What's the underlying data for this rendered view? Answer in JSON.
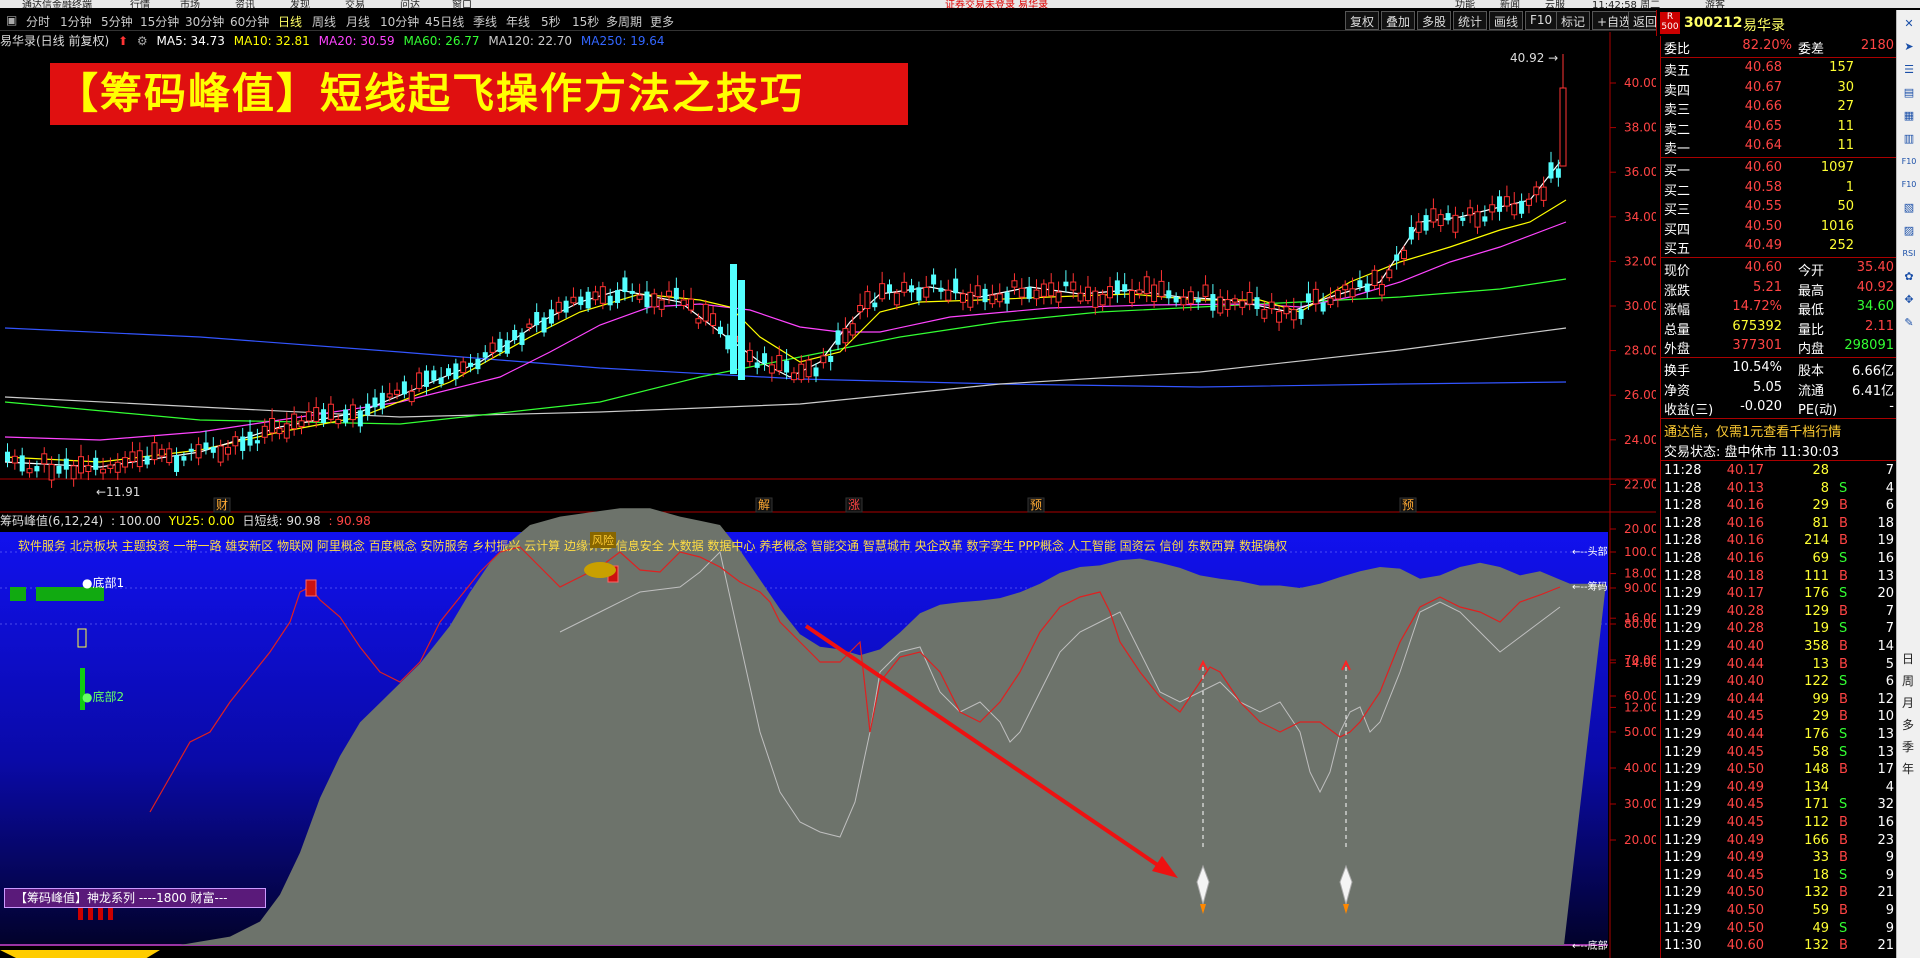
{
  "topbar": {
    "left_text": "通达信金融终端",
    "menus": [
      "行情",
      "市场",
      "资讯",
      "发现",
      "交易",
      "问达",
      "窗口"
    ],
    "center_text": "证券交易未登录  易华录",
    "right": [
      "功能",
      "新闻",
      "云服",
      "11:42:58 周二",
      "游客"
    ]
  },
  "periods": [
    "分时",
    "1分钟",
    "5分钟",
    "15分钟",
    "30分钟",
    "60分钟",
    "日线",
    "周线",
    "月线",
    "10分钟",
    "45日线",
    "季线",
    "年线",
    "5秒",
    "15秒",
    "多周期",
    "更多"
  ],
  "active_period": "日线",
  "toolbar": [
    "复权",
    "叠加",
    "多股",
    "统计",
    "画线",
    "F10",
    "标记",
    "+自选",
    "返回"
  ],
  "stock": {
    "rank_label": "R",
    "rank_num": "500",
    "code": "300212",
    "name": "易华录"
  },
  "ma_line": {
    "title": "易华录(日线 前复权)",
    "ma5": "MA5: 34.73",
    "ma10": "MA10: 32.81",
    "ma20": "MA20: 30.59",
    "ma60": "MA60: 26.77",
    "ma120": "MA120: 22.70",
    "ma250": "MA250: 19.64",
    "colors": {
      "ma5": "#ffffff",
      "ma10": "#ffff00",
      "ma20": "#ff44ff",
      "ma60": "#33ff33",
      "ma120": "#cccccc",
      "ma250": "#3355ff"
    }
  },
  "banner_text": "【筹码峰值】短线起飞操作方法之技巧",
  "price_axis": [
    "40.00",
    "38.00",
    "36.00",
    "34.00",
    "32.00",
    "30.00",
    "28.00",
    "26.00",
    "24.00",
    "22.00",
    "20.00",
    "18.00",
    "16.00",
    "14.00",
    "12.00"
  ],
  "high_label": "40.92",
  "low_label": "11.91",
  "event_marks": [
    "财",
    "解",
    "涨",
    "预",
    "预"
  ],
  "indicator": {
    "title": "筹码峰值(6,12,24)",
    "v1": ": 100.00",
    "yu25": "YU25: 0.00",
    "short": "日短线: 90.98",
    "v2": ": 90.98",
    "axis": [
      "100.0",
      "90.00",
      "80.00",
      "70.00",
      "60.00",
      "50.00",
      "40.00",
      "30.00",
      "20.00"
    ],
    "right_tags": [
      "头部",
      "筹码",
      "底部"
    ],
    "sectors": "软件服务 北京板块 主题投资 一带一路 雄安新区 物联网 阿里概念 百度概念 安防服务 乡村振兴 云计算 边缘计算 信息安全 大数据 数据中心 养老概念 智能交通 智慧城市 央企改革 数字孪生 PPP概念 人工智能 国资云 信创 东数西算 数据确权",
    "risk": "风险",
    "bottom1": "●底部1",
    "bottom2": "●底部2",
    "badge": "【筹码峰值】神龙系列 ----1800 财富---"
  },
  "quote": {
    "weibi_label": "委比",
    "weibi": "82.20%",
    "weicha_label": "委差",
    "weicha": "2180",
    "sells": [
      [
        "卖五",
        "40.68",
        "157"
      ],
      [
        "卖四",
        "40.67",
        "30"
      ],
      [
        "卖三",
        "40.66",
        "27"
      ],
      [
        "卖二",
        "40.65",
        "11"
      ],
      [
        "卖一",
        "40.64",
        "11"
      ]
    ],
    "buys": [
      [
        "买一",
        "40.60",
        "1097"
      ],
      [
        "买二",
        "40.58",
        "1"
      ],
      [
        "买三",
        "40.55",
        "50"
      ],
      [
        "买四",
        "40.50",
        "1016"
      ],
      [
        "买五",
        "40.49",
        "252"
      ]
    ],
    "stats": [
      [
        "现价",
        "40.60",
        "今开",
        "35.40"
      ],
      [
        "涨跌",
        "5.21",
        "最高",
        "40.92"
      ],
      [
        "涨幅",
        "14.72%",
        "最低",
        "34.60"
      ],
      [
        "总量",
        "675392",
        "量比",
        "2.11"
      ],
      [
        "外盘",
        "377301",
        "内盘",
        "298091"
      ]
    ],
    "stats2": [
      [
        "换手",
        "10.54%",
        "股本",
        "6.66亿"
      ],
      [
        "净资",
        "5.05",
        "流通",
        "6.41亿"
      ],
      [
        "收益(三)",
        "-0.020",
        "PE(动)",
        "-"
      ]
    ],
    "promo": "通达信，仅需1元查看千档行情",
    "status": "交易状态: 盘中休市 11:30:03",
    "ticks": [
      [
        "11:28",
        "40.17",
        "28",
        "",
        "7"
      ],
      [
        "11:28",
        "40.13",
        "8",
        "S",
        "4"
      ],
      [
        "11:28",
        "40.16",
        "29",
        "B",
        "6"
      ],
      [
        "11:28",
        "40.16",
        "81",
        "B",
        "18"
      ],
      [
        "11:28",
        "40.16",
        "214",
        "B",
        "19"
      ],
      [
        "11:28",
        "40.16",
        "69",
        "S",
        "16"
      ],
      [
        "11:28",
        "40.18",
        "111",
        "B",
        "13"
      ],
      [
        "11:29",
        "40.17",
        "176",
        "S",
        "20"
      ],
      [
        "11:29",
        "40.28",
        "129",
        "B",
        "7"
      ],
      [
        "11:29",
        "40.28",
        "19",
        "S",
        "7"
      ],
      [
        "11:29",
        "40.40",
        "358",
        "B",
        "14"
      ],
      [
        "11:29",
        "40.44",
        "13",
        "B",
        "5"
      ],
      [
        "11:29",
        "40.40",
        "122",
        "S",
        "6"
      ],
      [
        "11:29",
        "40.44",
        "99",
        "B",
        "12"
      ],
      [
        "11:29",
        "40.45",
        "29",
        "B",
        "10"
      ],
      [
        "11:29",
        "40.44",
        "176",
        "S",
        "13"
      ],
      [
        "11:29",
        "40.45",
        "58",
        "S",
        "13"
      ],
      [
        "11:29",
        "40.50",
        "148",
        "B",
        "17"
      ],
      [
        "11:29",
        "40.49",
        "134",
        "",
        "4"
      ],
      [
        "11:29",
        "40.45",
        "171",
        "S",
        "32"
      ],
      [
        "11:29",
        "40.45",
        "112",
        "B",
        "16"
      ],
      [
        "11:29",
        "40.49",
        "166",
        "B",
        "23"
      ],
      [
        "11:29",
        "40.49",
        "33",
        "B",
        "9"
      ],
      [
        "11:29",
        "40.45",
        "18",
        "S",
        "9"
      ],
      [
        "11:29",
        "40.50",
        "132",
        "B",
        "21"
      ],
      [
        "11:29",
        "40.50",
        "59",
        "B",
        "9"
      ],
      [
        "11:29",
        "40.50",
        "49",
        "S",
        "9"
      ],
      [
        "11:30",
        "40.60",
        "132",
        "B",
        "21"
      ]
    ]
  },
  "sidebar": {
    "icons": [
      "cross-icon",
      "arrow-icon",
      "list-icon",
      "chart-icon",
      "grid-icon",
      "bar-icon",
      "f10-icon",
      "f10b-icon",
      "chart2-icon",
      "chart3-icon",
      "rsi-icon",
      "flower-icon",
      "expand-icon",
      "pen-icon"
    ],
    "words": [
      "日",
      "周",
      "月",
      "多",
      "季",
      "年"
    ],
    "rsi": "RSI"
  },
  "colors": {
    "up": "#ff3333",
    "down": "#54ffff",
    "yellow": "#ffff00",
    "frame": "#aa0000"
  }
}
